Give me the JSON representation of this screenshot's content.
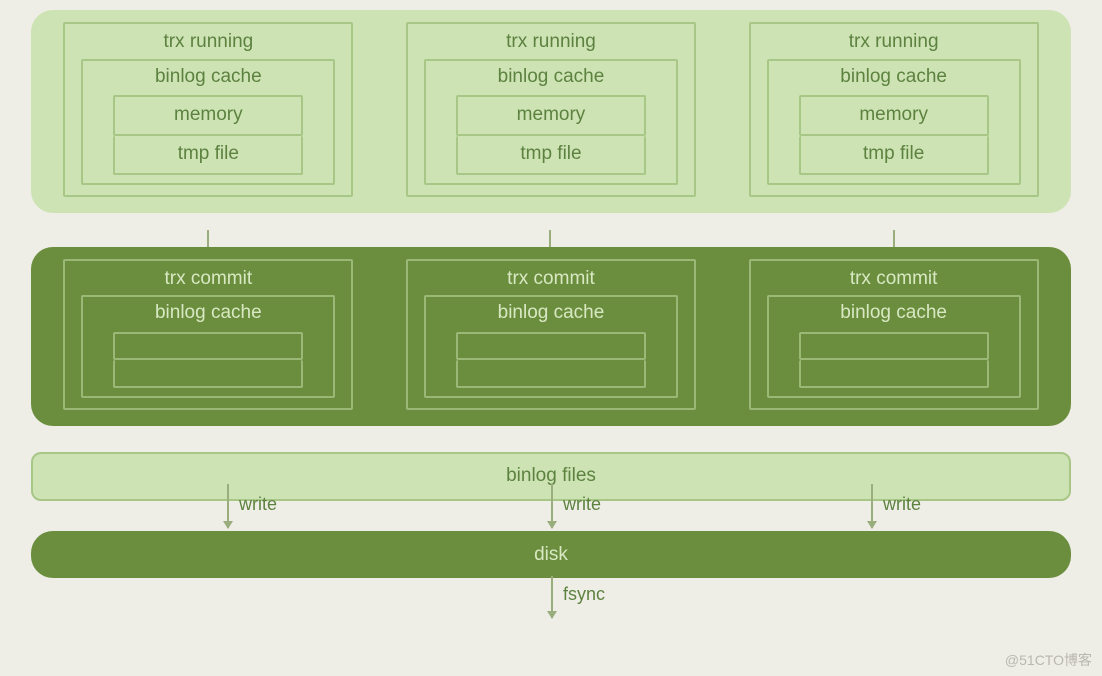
{
  "running": {
    "title": "trx running",
    "cache": "binlog cache",
    "memory": "memory",
    "tmp": "tmp file"
  },
  "commit": {
    "title": "trx commit",
    "cache": "binlog cache"
  },
  "labels": {
    "write": "write",
    "fsync": "fsync",
    "binlog_files": "binlog files",
    "disk": "disk"
  },
  "watermark": "@51CTO博客"
}
